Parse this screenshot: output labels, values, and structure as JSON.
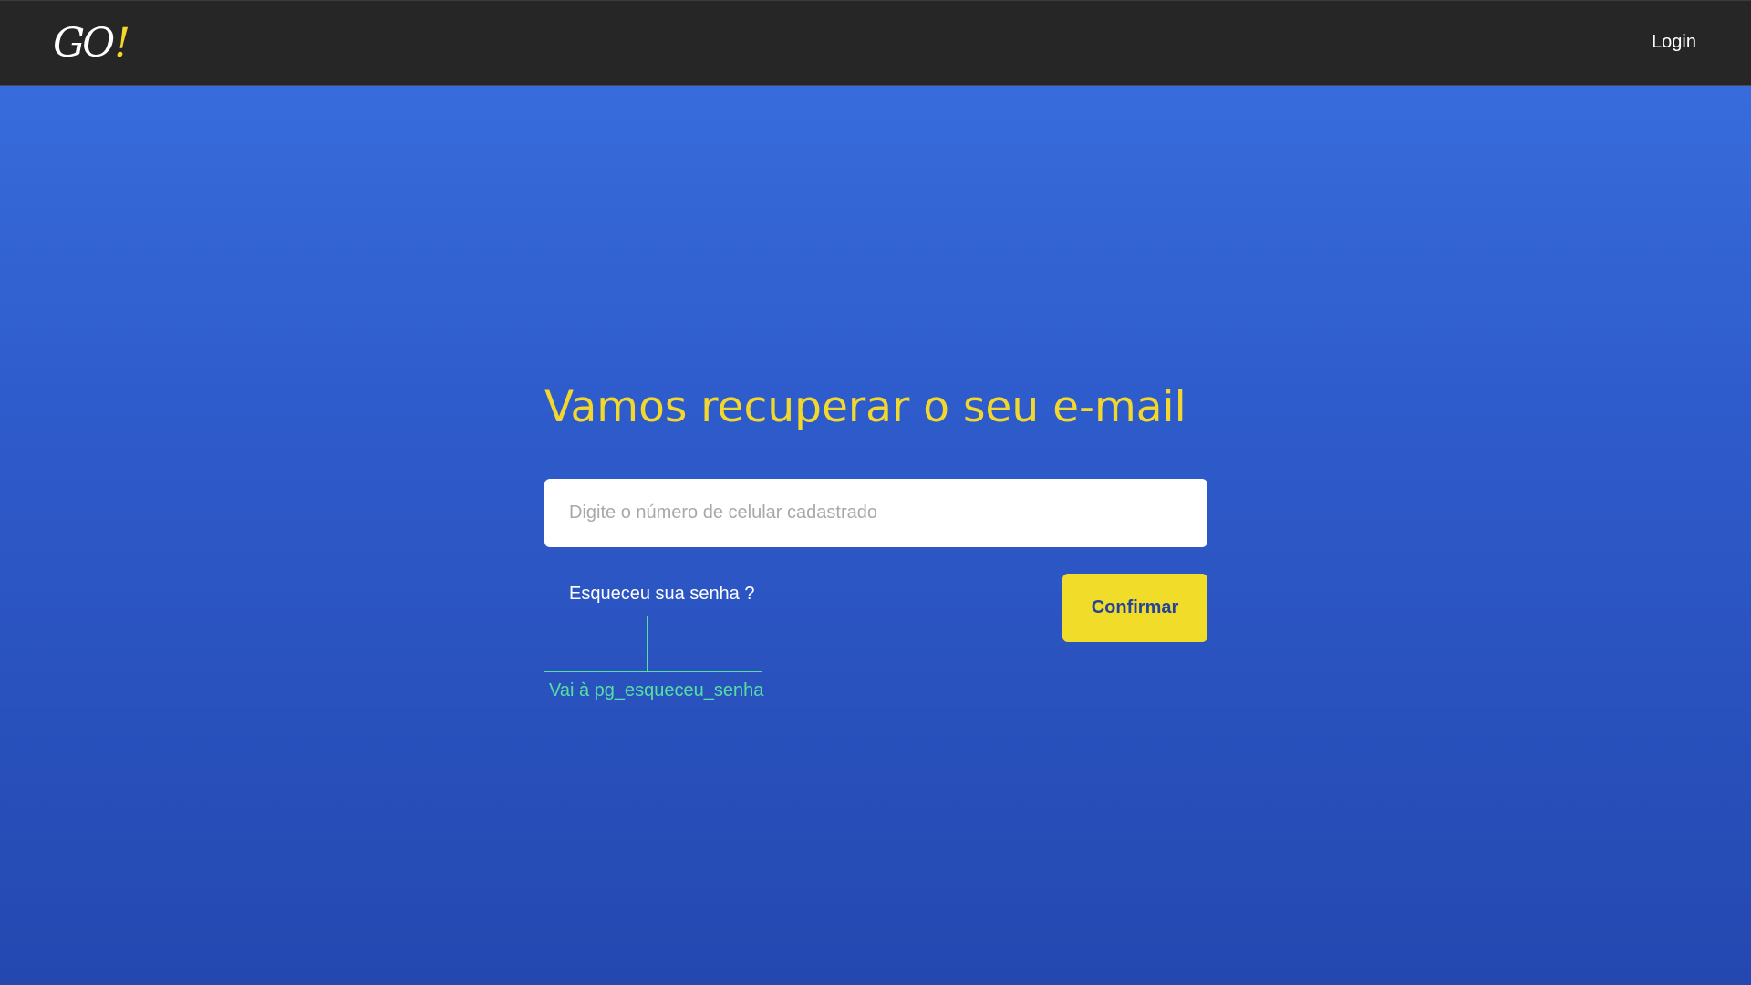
{
  "header": {
    "logo_text": "GO",
    "logo_accent": "!",
    "login_label": "Login"
  },
  "main": {
    "title": "Vamos recuperar o seu e-mail",
    "phone_placeholder": "Digite o número de celular cadastrado",
    "phone_value": "",
    "forgot_label": "Esqueceu sua senha ?",
    "confirm_label": "Confirmar"
  },
  "annotation": {
    "text": "Vai à pg_esqueceu_senha"
  },
  "colors": {
    "accent_yellow": "#f2d72d",
    "header_bg": "#262626",
    "bg_top": "#3a70e0",
    "bg_bottom": "#2448b0",
    "annotation_green": "#55e0a0"
  }
}
